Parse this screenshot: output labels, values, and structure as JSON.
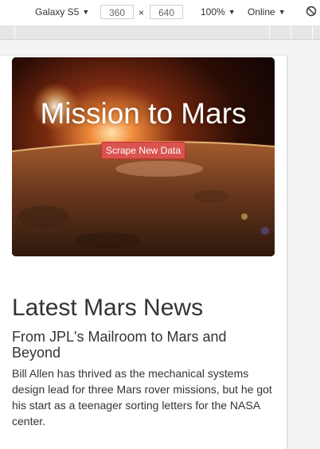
{
  "toolbar": {
    "device": "Galaxy S5",
    "width": "360",
    "height": "640",
    "separator": "×",
    "zoom": "100%",
    "network": "Online",
    "icons": [
      "caret-down-icon",
      "rotate-icon"
    ]
  },
  "hero": {
    "title": "Mission to Mars",
    "button_label": "Scrape New Data"
  },
  "news": {
    "heading": "Latest Mars News",
    "title": "From JPL's Mailroom to Mars and Beyond",
    "body": "Bill Allen has thrived as the mechanical systems design lead for three Mars rover missions, but he got his start as a teenager sorting letters for the NASA center."
  },
  "colors": {
    "button": "#d9534f",
    "text": "#333333",
    "page": "#ffffff"
  }
}
